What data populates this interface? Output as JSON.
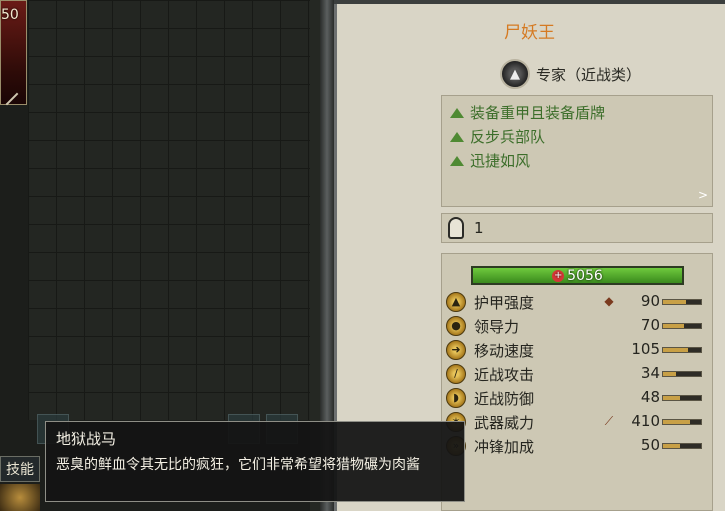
{
  "unit": {
    "badge": "50"
  },
  "skills_tab": "技能",
  "panel": {
    "title": "尸妖王",
    "class_label": "专家（近战类）",
    "traits": [
      "装备重甲且装备盾牌",
      "反步兵部队",
      "迅捷如风"
    ],
    "traits_more": ">",
    "men_count": "1",
    "hp": "5056"
  },
  "stats": [
    {
      "label": "护甲强度",
      "value": "90",
      "fill": 0.6
    },
    {
      "label": "领导力",
      "value": "70",
      "fill": 0.55
    },
    {
      "label": "移动速度",
      "value": "105",
      "fill": 0.65
    },
    {
      "label": "近战攻击",
      "value": "34",
      "fill": 0.35
    },
    {
      "label": "近战防御",
      "value": "48",
      "fill": 0.45
    },
    {
      "label": "武器威力",
      "value": "410",
      "fill": 0.7
    },
    {
      "label": "冲锋加成",
      "value": "50",
      "fill": 0.45
    }
  ],
  "tooltip": {
    "title": "地狱战马",
    "body": "恶臭的鲜血令其无比的疯狂，它们非常希望将猎物碾为肉酱"
  }
}
